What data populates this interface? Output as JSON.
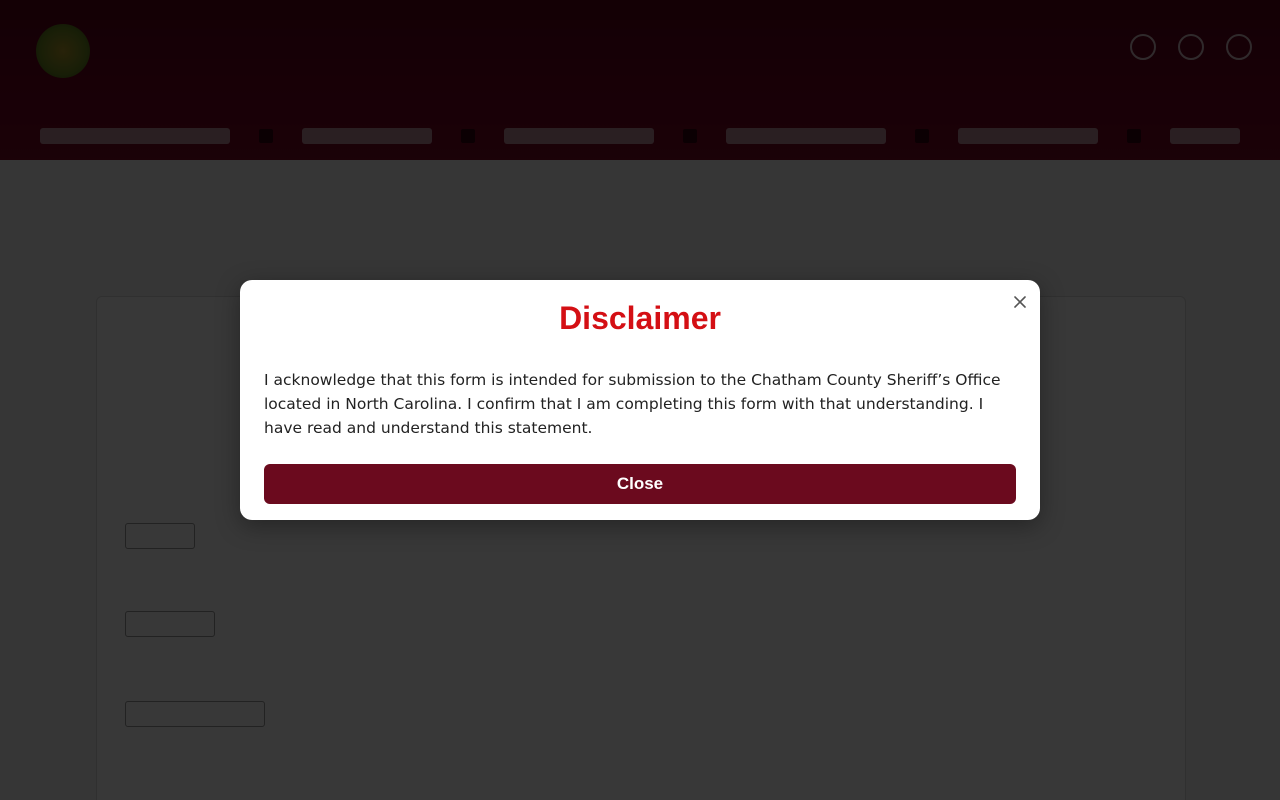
{
  "modal": {
    "title": "Disclaimer",
    "body": "I acknowledge that this form is intended for submission to the Chatham County Sheriff’s Office located in North Carolina. I confirm that I am completing this form with that understanding. I have read and understand this statement.",
    "close_button_label": "Close",
    "close_icon": "close-icon",
    "title_color": "#d40f14",
    "button_color": "#6b0a1e"
  },
  "colors": {
    "header_background": "#700020",
    "overlay": "rgba(0,0,0,0.78)"
  }
}
